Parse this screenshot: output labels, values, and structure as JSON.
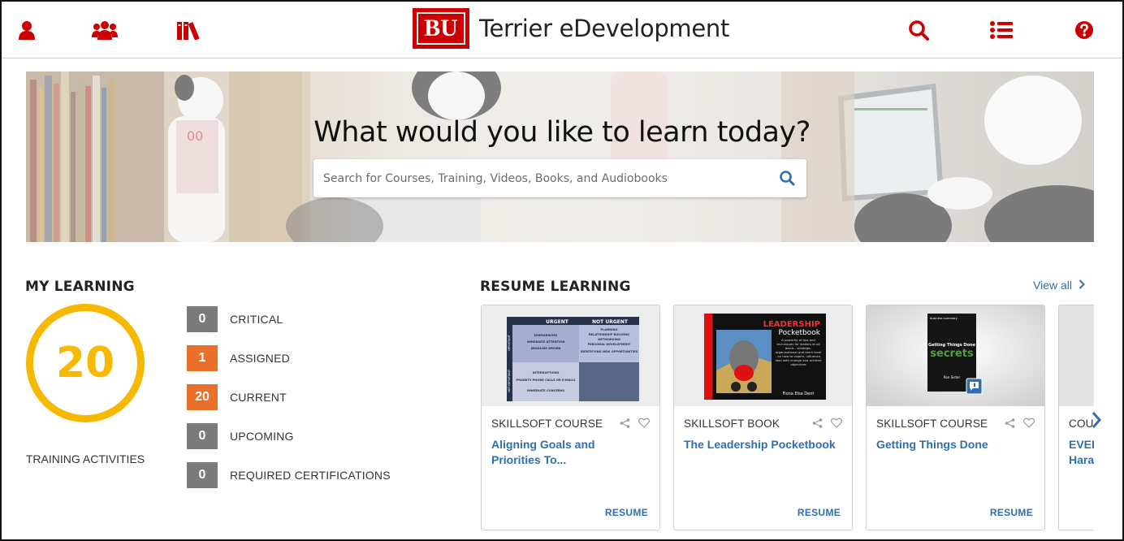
{
  "header": {
    "brand_logo_text": "BU",
    "brand_title": "Terrier eDevelopment",
    "icons": [
      "user-icon",
      "users-icon",
      "library-icon",
      "search-icon",
      "list-icon",
      "help-icon"
    ]
  },
  "hero": {
    "headline": "What would you like to learn today?",
    "search_placeholder": "Search for Courses, Training, Videos, Books, and Audiobooks"
  },
  "my_learning": {
    "title": "MY LEARNING",
    "total": "20",
    "total_label": "TRAINING ACTIVITIES",
    "stats": [
      {
        "count": "0",
        "label": "CRITICAL",
        "color": "#7b7b7b"
      },
      {
        "count": "1",
        "label": "ASSIGNED",
        "color": "#e8702a"
      },
      {
        "count": "20",
        "label": "CURRENT",
        "color": "#e8702a"
      },
      {
        "count": "0",
        "label": "UPCOMING",
        "color": "#7b7b7b"
      },
      {
        "count": "0",
        "label": "REQUIRED CERTIFICATIONS",
        "color": "#7b7b7b"
      }
    ]
  },
  "resume_learning": {
    "title": "RESUME LEARNING",
    "view_all": "View all",
    "cards": [
      {
        "type": "SKILLSOFT COURSE",
        "title": "Aligning Goals and Priorities To...",
        "action": "RESUME",
        "thumb": {
          "matrix_headers": [
            "URGENT",
            "NOT URGENT"
          ],
          "row_labels": [
            "IMPORTANT",
            "NOT IMPORTANT"
          ],
          "q1": [
            "EMERGENCIES",
            "IMMEDIATE ATTENTION",
            "DEADLINE DRIVEN"
          ],
          "q2": [
            "PLANNING",
            "RELATIONSHIP BUILDING",
            "NETWORKING",
            "PERSONAL DEVELOPMENT",
            "IDENTIFYING NEW OPPORTUNITIES"
          ],
          "q3": [
            "INTERRUPTIONS",
            "PRIORITY PHONE CALLS OR E-MAILS",
            "IMMEDIATE CONCERNS"
          ]
        }
      },
      {
        "type": "SKILLSOFT BOOK",
        "title": "The Leadership Pocketbook",
        "action": "RESUME",
        "thumb": {
          "cover_title_1": "LEADERSHIP",
          "cover_title_2": "Pocketbook",
          "blurb": "A powerful of tips and techniques for leaders at all levels - strategic, organisational and team level - on how to inspire, influence, deal with change and achieve objectives",
          "author": "Fiona Elsa Dent"
        }
      },
      {
        "type": "SKILLSOFT COURSE",
        "title": "Getting Things Done",
        "action": "RESUME",
        "thumb": {
          "publisher": "business summary",
          "cover_line_1": "Getting Things Done",
          "cover_line_2": "secrets",
          "author": "Ron Sister"
        }
      },
      {
        "type": "COU",
        "title_lines": [
          "EVER",
          "Hara"
        ],
        "action": ""
      }
    ]
  }
}
